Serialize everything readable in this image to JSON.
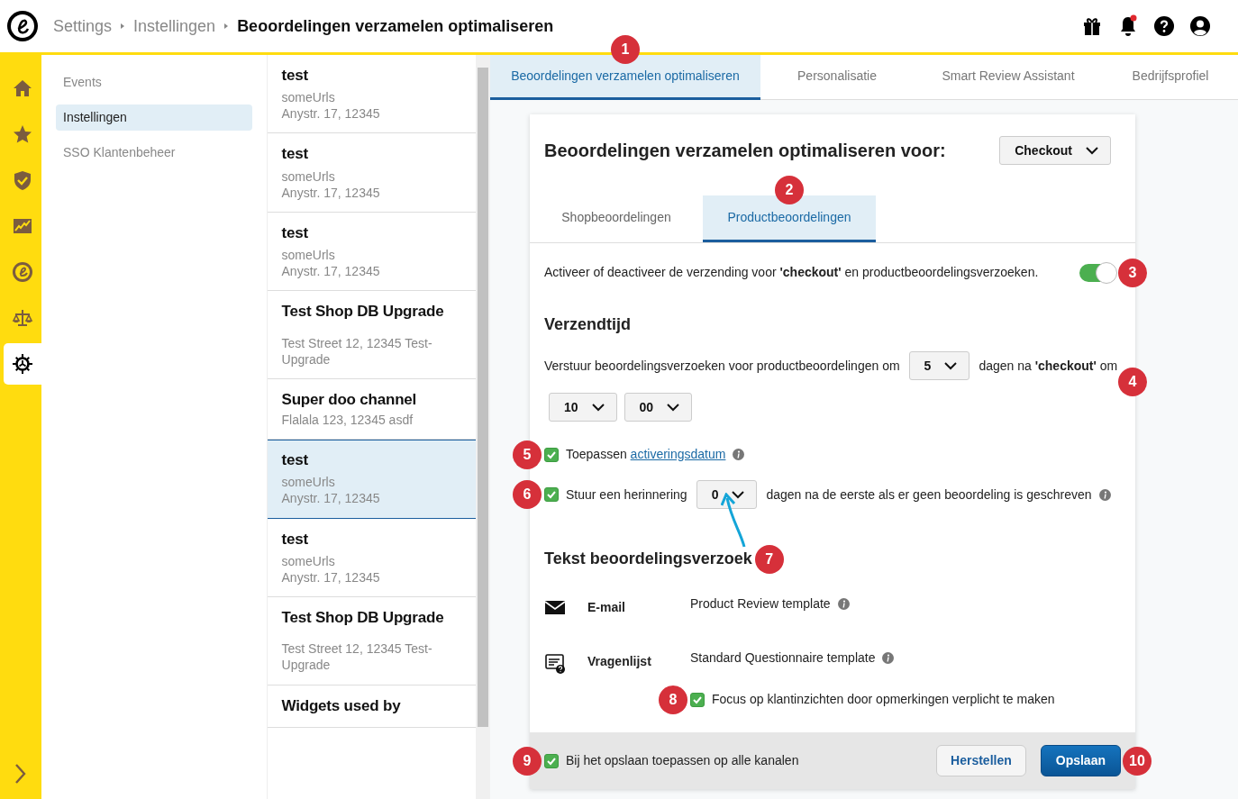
{
  "header": {
    "breadcrumbs": [
      {
        "label": "Settings",
        "current": false
      },
      {
        "label": "Instellingen",
        "current": false
      },
      {
        "label": "Beoordelingen verzamelen optimaliseren",
        "current": true
      }
    ],
    "notification": true
  },
  "rail": {
    "items": [
      {
        "kind": "home",
        "selected": false
      },
      {
        "kind": "star",
        "selected": false
      },
      {
        "kind": "shield",
        "selected": false
      },
      {
        "kind": "chart",
        "selected": false
      },
      {
        "kind": "logo",
        "selected": false
      },
      {
        "kind": "scales",
        "selected": false
      },
      {
        "kind": "gear",
        "selected": true
      }
    ]
  },
  "submenu": [
    {
      "label": "Events",
      "selected": false
    },
    {
      "label": "Instellingen",
      "selected": true
    },
    {
      "label": "SSO Klantenbeheer",
      "selected": false
    }
  ],
  "channels": [
    {
      "name": "test",
      "url": "someUrls",
      "address": "Anystr. 17, 12345",
      "selected": false
    },
    {
      "name": "test",
      "url": "someUrls",
      "address": "Anystr. 17, 12345",
      "selected": false
    },
    {
      "name": "test",
      "url": "someUrls",
      "address": "Anystr. 17, 12345",
      "selected": false
    },
    {
      "name": "Test Shop DB Upgrade",
      "address": "Test Street 12, 12345 Test-Upgrade",
      "selected": false
    },
    {
      "name": "Super doo channel",
      "address": "Flalala 123, 12345 asdf",
      "selected": false
    },
    {
      "name": "test",
      "url": "someUrls",
      "address": "Anystr. 17, 12345",
      "selected": true
    },
    {
      "name": "test",
      "url": "someUrls",
      "address": "Anystr. 17, 12345",
      "selected": false
    },
    {
      "name": "Test Shop DB Upgrade",
      "address": "Test Street 12, 12345 Test-Upgrade",
      "selected": false
    },
    {
      "name": "Widgets used by",
      "selected": false
    }
  ],
  "tabs": [
    {
      "label": "Beoordelingen verzamelen optimaliseren",
      "selected": true,
      "callout": "1"
    },
    {
      "label": "Personalisatie",
      "selected": false
    },
    {
      "label": "Smart Review Assistant",
      "selected": false
    },
    {
      "label": "Bedrijfsprofiel",
      "selected": false
    }
  ],
  "panel": {
    "title": "Beoordelingen verzamelen optimaliseren voor:",
    "event_select": "Checkout",
    "subtabs": [
      {
        "label": "Shopbeoordelingen",
        "selected": false
      },
      {
        "label": "Productbeoordelingen",
        "selected": true,
        "callout": "2"
      }
    ],
    "toggle": {
      "text": "Activeer of deactiveer de verzending voor **'checkout'** en productbeoordelingsverzoeken.",
      "on": true,
      "callout": "3"
    },
    "timing": {
      "heading": "Verzendtijd",
      "text_before": "Verstuur beoordelingsverzoeken voor productbeoordelingen om",
      "days": "5",
      "text_after": "dagen na **'checkout'** om",
      "hour": "10",
      "minute": "00",
      "callout": "4"
    },
    "activation": {
      "checked": true,
      "label": "Toepassen",
      "link": "activeringsdatum",
      "callout": "5"
    },
    "reminder": {
      "checked": true,
      "label": "Stuur een herinnering",
      "days": "0",
      "text_after": "dagen na de eerste als er geen beoordeling is geschreven",
      "callout": "6"
    },
    "request_text": {
      "heading": "Tekst beoordelingsverzoek",
      "callout": "7"
    },
    "templates": [
      {
        "kind": "email",
        "label": "E-mail",
        "template": "Product Review template"
      },
      {
        "kind": "questionnaire",
        "label": "Vragenlijst",
        "template": "Standard Questionnaire template"
      }
    ],
    "focus": {
      "checked": true,
      "label": "Focus op klantinzichten door opmerkingen verplicht te maken",
      "callout": "8"
    },
    "footer": {
      "apply_all": {
        "checked": true,
        "label": "Bij het opslaan toepassen op alle kanalen",
        "callout": "9"
      },
      "buttons": [
        {
          "label": "Herstellen",
          "kind": "secondary"
        },
        {
          "label": "Opslaan",
          "kind": "primary",
          "callout": "10"
        }
      ]
    }
  }
}
